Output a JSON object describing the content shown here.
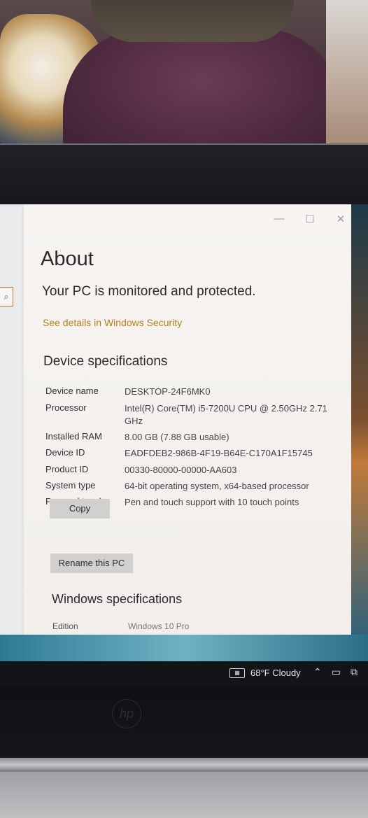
{
  "window": {
    "title": "About",
    "status": "Your PC is monitored and protected.",
    "security_link": "See details in Windows Security",
    "controls": {
      "minimize": "—",
      "maximize": "☐",
      "close": "✕"
    }
  },
  "device_specs": {
    "heading": "Device specifications",
    "rows": [
      {
        "label": "Device name",
        "value": "DESKTOP-24F6MK0"
      },
      {
        "label": "Processor",
        "value": "Intel(R) Core(TM) i5-7200U CPU @ 2.50GHz   2.71 GHz"
      },
      {
        "label": "Installed RAM",
        "value": "8.00 GB (7.88 GB usable)"
      },
      {
        "label": "Device ID",
        "value": "EADFDEB2-986B-4F19-B64E-C170A1F15745"
      },
      {
        "label": "Product ID",
        "value": "00330-80000-00000-AA603"
      },
      {
        "label": "System type",
        "value": "64-bit operating system, x64-based processor"
      },
      {
        "label": "Pen and touch",
        "value": "Pen and touch support with 10 touch points"
      }
    ],
    "copy_label": "Copy",
    "rename_label": "Rename this PC"
  },
  "windows_specs": {
    "heading": "Windows specifications",
    "edition_label": "Edition",
    "edition_value": "Windows 10 Pro"
  },
  "taskbar": {
    "weather_text": "68°F  Cloudy",
    "icons": [
      "weather-icon",
      "chevron-up-icon",
      "battery-icon",
      "network-icon"
    ]
  },
  "colors": {
    "link": "#b4811a",
    "window_bg": "#f4f1ee",
    "button_bg": "#d2d0ce",
    "taskbar_bg": "#121418"
  }
}
